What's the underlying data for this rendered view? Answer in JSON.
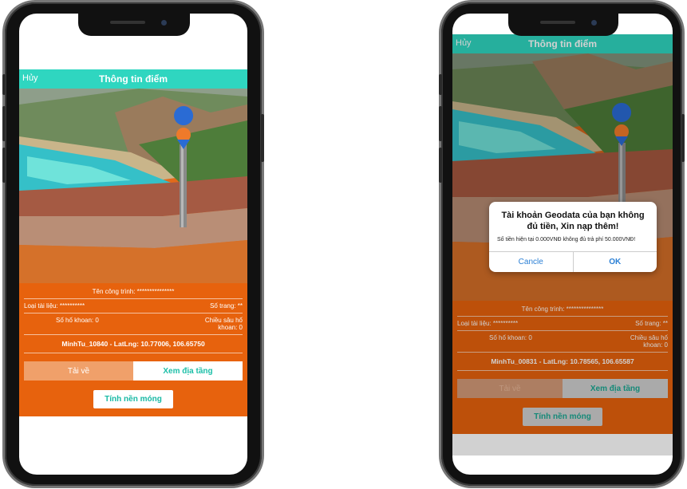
{
  "screens": [
    {
      "header": {
        "cancel": "Hủy",
        "title": "Thông tin điểm"
      },
      "info": {
        "project": "Tên công trình: ***************",
        "doc_type": "Loại tài liệu: **********",
        "pages": "Số trang: **",
        "boreholes": "Số hố khoan: 0",
        "depth": "Chiều sâu hố khoan: 0",
        "coords": "MinhTu_10840 - LatLng: 10.77006, 106.65750"
      },
      "tabs": {
        "download": "Tải về",
        "view_layers": "Xem địa tầng"
      },
      "calc_button": "Tính nền móng"
    },
    {
      "header": {
        "cancel": "Hủy",
        "title": "Thông tin điểm"
      },
      "info": {
        "project": "Tên công trình: ***************",
        "doc_type": "Loại tài liệu: **********",
        "pages": "Số trang: **",
        "boreholes": "Số hố khoan: 0",
        "depth": "Chiều sâu hố khoan: 0",
        "coords": "MinhTu_00831 - LatLng: 10.78565, 106.65587"
      },
      "tabs": {
        "download": "Tải về",
        "view_layers": "Xem địa tầng"
      },
      "calc_button": "Tính nền móng",
      "dialog": {
        "title": "Tài khoản Geodata của bạn không đủ tiền, Xin nạp thêm!",
        "message": "Số tiền hiện tại 0.000VNĐ không đủ trả phí 50.000VNĐ!",
        "cancel": "Cancle",
        "ok": "OK"
      }
    }
  ],
  "colors": {
    "header": "#2fd6c0",
    "info_bg": "#e7620d",
    "accent_text": "#1cbfa8",
    "dialog_button": "#2a7fd5"
  }
}
